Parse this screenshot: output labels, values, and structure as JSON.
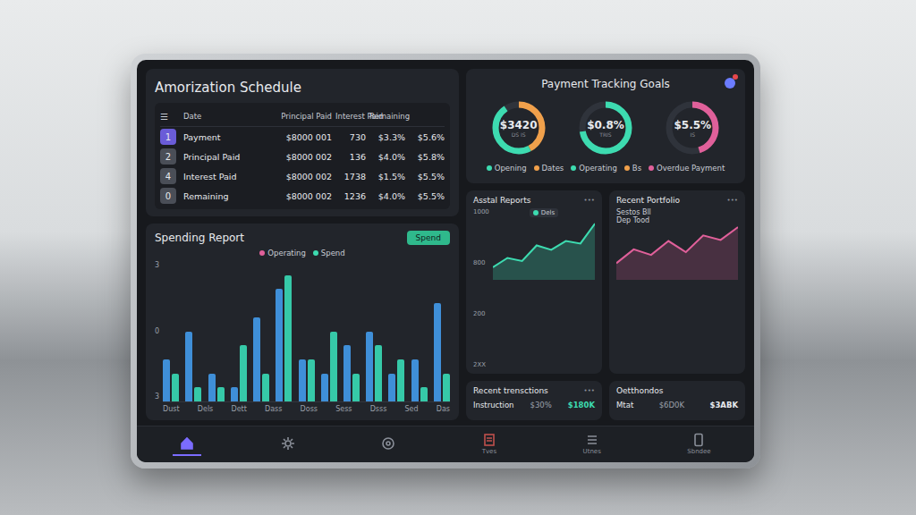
{
  "schedule": {
    "title": "Amorization Schedule",
    "menu_icon": "☰",
    "columns": [
      "Date",
      "Principal Paid",
      "Interest Paid",
      "Remaining"
    ],
    "rows": [
      {
        "num": "1",
        "label": "Payment",
        "principal": "$8000 001",
        "interest": "730",
        "rate": "$3.3%",
        "remaining": "$5.6%",
        "selected": true
      },
      {
        "num": "2",
        "label": "Principal Paid",
        "principal": "$8000 002",
        "interest": "136",
        "rate": "$4.0%",
        "remaining": "$5.8%",
        "selected": false
      },
      {
        "num": "4",
        "label": "Interest Paid",
        "principal": "$8000 002",
        "interest": "1738",
        "rate": "$1.5%",
        "remaining": "$5.5%",
        "selected": false
      },
      {
        "num": "0",
        "label": "Remaining",
        "principal": "$8000 002",
        "interest": "1236",
        "rate": "$4.0%",
        "remaining": "$5.5%",
        "selected": false
      }
    ]
  },
  "goals": {
    "title": "Payment Tracking Goals",
    "notification": true,
    "donuts": [
      {
        "value": "$3420",
        "caption": "DS IS",
        "segments": [
          {
            "color": "#f0a04b",
            "level": 0.42
          },
          {
            "color": "#3ddbb0",
            "level": 0.48
          }
        ]
      },
      {
        "value": "$0.8%",
        "caption": "TRIS",
        "segments": [
          {
            "color": "#3ddbb0",
            "level": 0.72
          }
        ]
      },
      {
        "value": "$5.5%",
        "caption": "IS",
        "segments": [
          {
            "color": "#e0609a",
            "level": 0.45
          }
        ]
      }
    ],
    "legend": [
      {
        "label": "Opening",
        "color": "#3ddbb0"
      },
      {
        "label": "Dates",
        "color": "#f0a04b"
      },
      {
        "label": "Operating",
        "color": "#3ddbb0"
      },
      {
        "label": "Bs",
        "color": "#f0a04b"
      },
      {
        "label": "Overdue Payment",
        "color": "#e0609a"
      }
    ]
  },
  "spending": {
    "title": "Spending Report",
    "button": "Spend",
    "legend": [
      {
        "label": "Operating",
        "color": "#e0609a"
      },
      {
        "label": "Spend",
        "color": "#3ddbb0"
      }
    ],
    "y_ticks": [
      "3",
      "0",
      "3"
    ],
    "x_labels": [
      "Dust",
      "Dels",
      "Dett",
      "Dass",
      "Doss",
      "Sess",
      "Dsss",
      "Sed",
      "Das"
    ],
    "series": [
      {
        "name": "Operating",
        "color": "#3f8fd8",
        "values": [
          3,
          5,
          2,
          1,
          6,
          8,
          3,
          2,
          4,
          5,
          2,
          3,
          7
        ]
      },
      {
        "name": "Spend",
        "color": "#36c9a8",
        "values": [
          2,
          1,
          1,
          4,
          2,
          9,
          3,
          5,
          2,
          4,
          3,
          1,
          2
        ]
      }
    ],
    "max": 10
  },
  "asset": {
    "title": "Asstal Reports",
    "legend": "Dels",
    "y_ticks": [
      "1000",
      "800",
      "200",
      "2XX"
    ],
    "values": [
      20,
      35,
      30,
      55,
      48,
      62,
      58,
      90
    ],
    "max": 100,
    "color": "#3ddbb0"
  },
  "portfolio": {
    "title": "Recent Portfolio",
    "lines": [
      "Sestos Bll",
      "Dep Tood"
    ],
    "values": [
      30,
      55,
      45,
      70,
      50,
      80,
      72,
      95
    ],
    "max": 100,
    "color": "#e0609a"
  },
  "transactions": {
    "title": "Recent trensctions",
    "label": "Instruction",
    "value": "$30%",
    "amount": "$180K"
  },
  "holdings": {
    "title": "Oetthondos",
    "label": "Mtat",
    "value": "$6D0K",
    "amount": "$3ABK"
  },
  "nav": [
    {
      "icon": "home",
      "selected": true
    },
    {
      "icon": "gear",
      "selected": false
    },
    {
      "icon": "target",
      "selected": false
    },
    {
      "icon": "doc",
      "label": "Tves",
      "selected": false
    },
    {
      "icon": "list",
      "label": "Utnes",
      "selected": false
    },
    {
      "icon": "phone",
      "label": "Sbndee",
      "selected": false
    }
  ]
}
